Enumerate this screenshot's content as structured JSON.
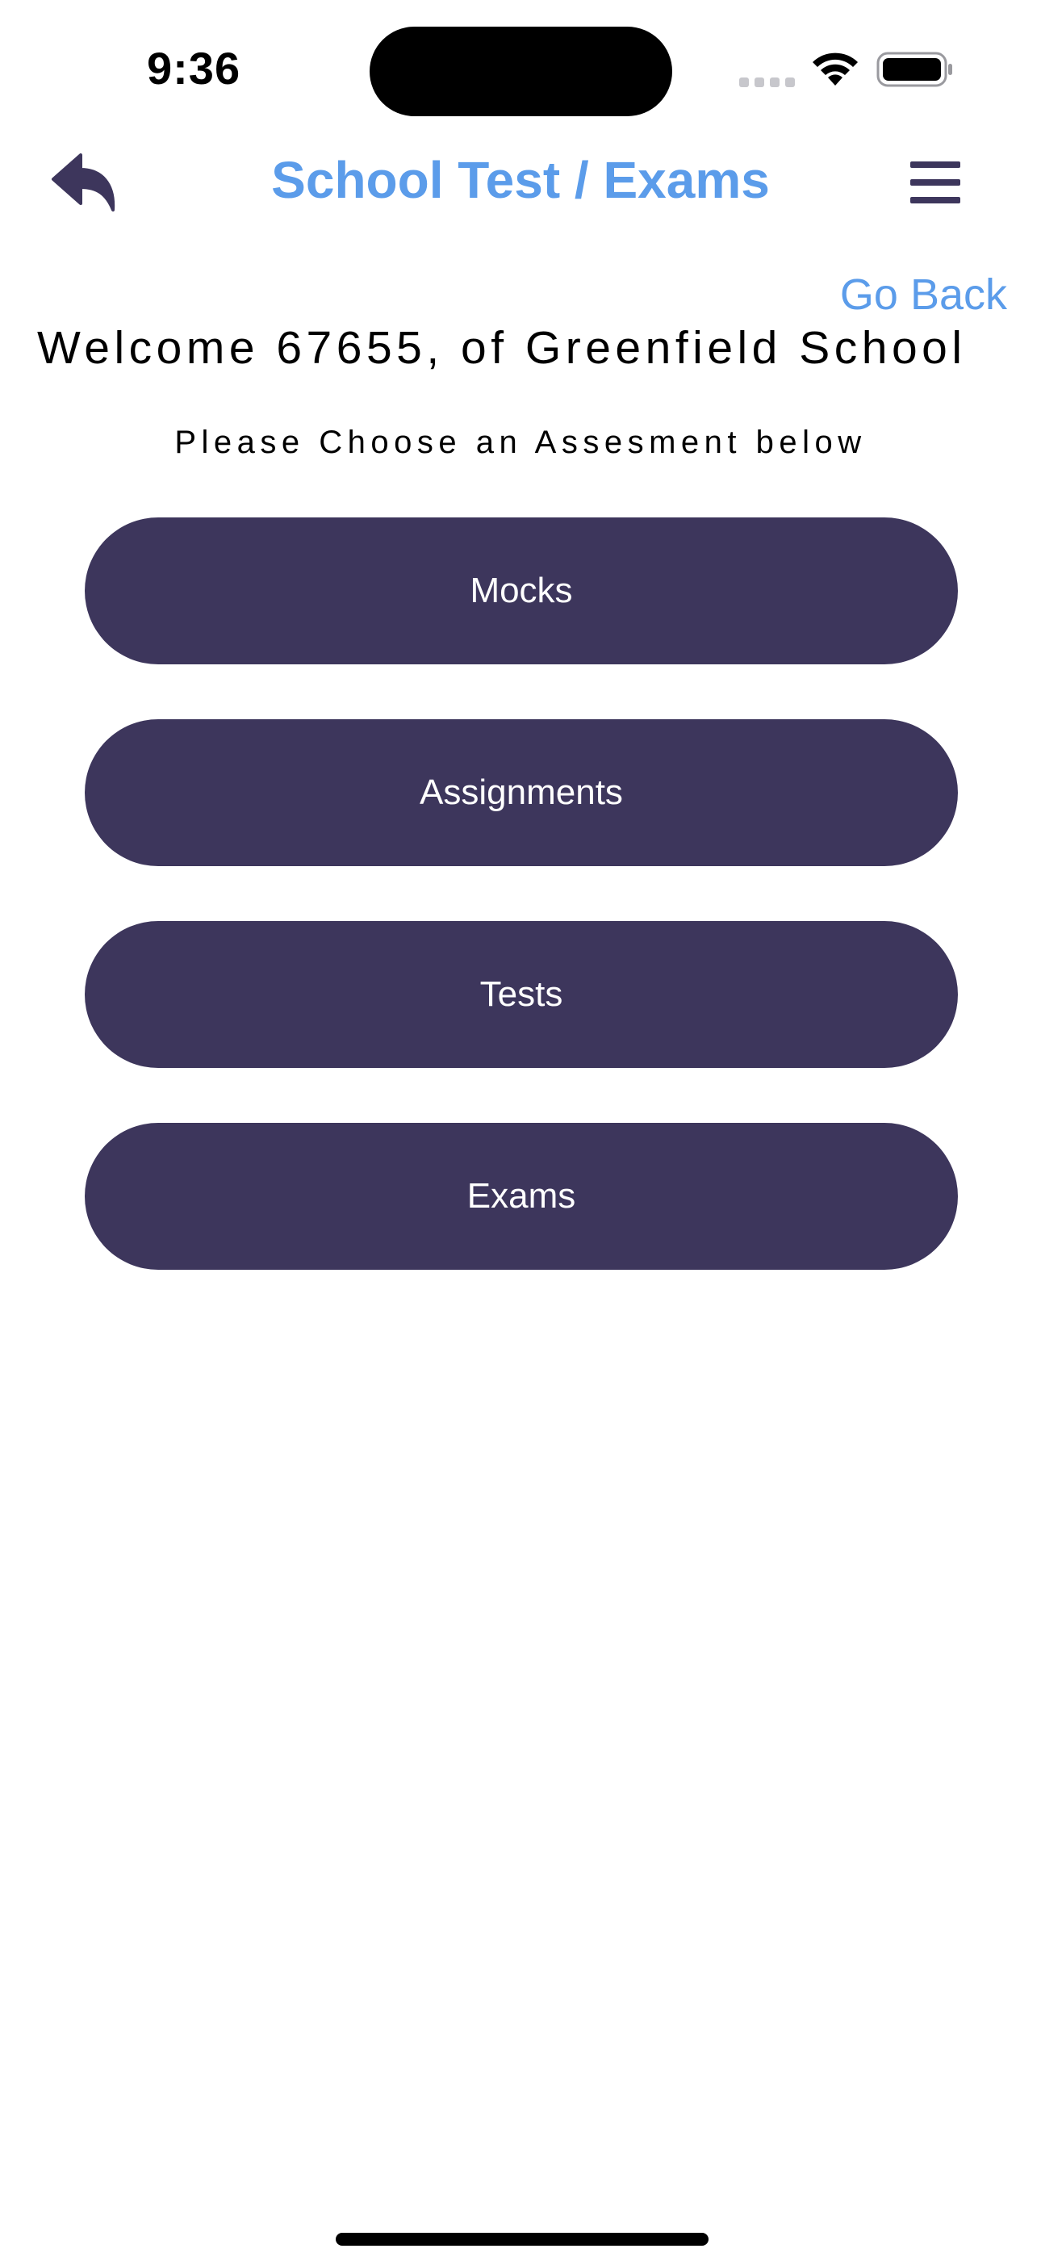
{
  "status_bar": {
    "time": "9:36"
  },
  "header": {
    "title": "School Test / Exams",
    "back_icon": "reply-arrow-icon",
    "menu_icon": "hamburger-menu-icon"
  },
  "go_back_label": "Go Back",
  "welcome_text": "Welcome 67655, of Greenfield School",
  "instruction_text": "Please Choose an Assesment below",
  "buttons": [
    {
      "label": "Mocks"
    },
    {
      "label": "Assignments"
    },
    {
      "label": "Tests"
    },
    {
      "label": "Exams"
    }
  ],
  "colors": {
    "accent": "#5b9cea",
    "button_bg": "#3d365c",
    "icon": "#3d365c"
  }
}
